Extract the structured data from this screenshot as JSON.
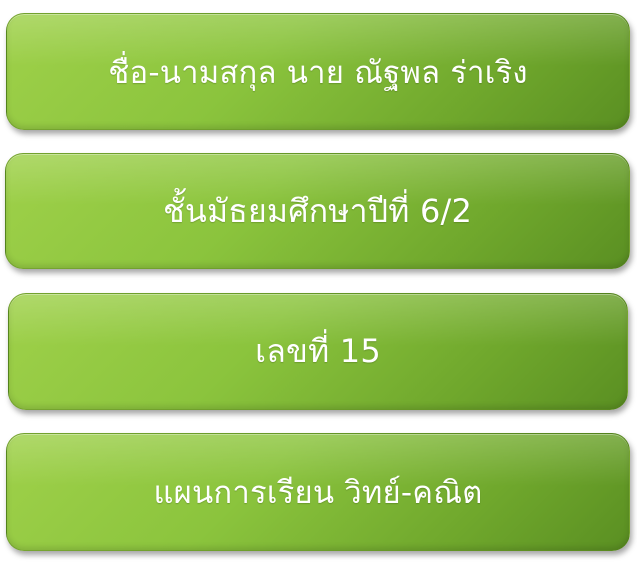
{
  "colors": {
    "card_light": "#9fd14a",
    "card_mid": "#8bc43d",
    "card_dark": "#5a8f22",
    "text": "#ffffff",
    "background": "#ffffff"
  },
  "cards": [
    {
      "text": "ชื่อ-นามสกุล นาย ณัฐพล  ร่าเริง"
    },
    {
      "text": "ชั้นมัธยมศึกษาปีที่ 6/2"
    },
    {
      "text": "เลขที่ 15"
    },
    {
      "text": "แผนการเรียน วิทย์-คณิต"
    }
  ]
}
